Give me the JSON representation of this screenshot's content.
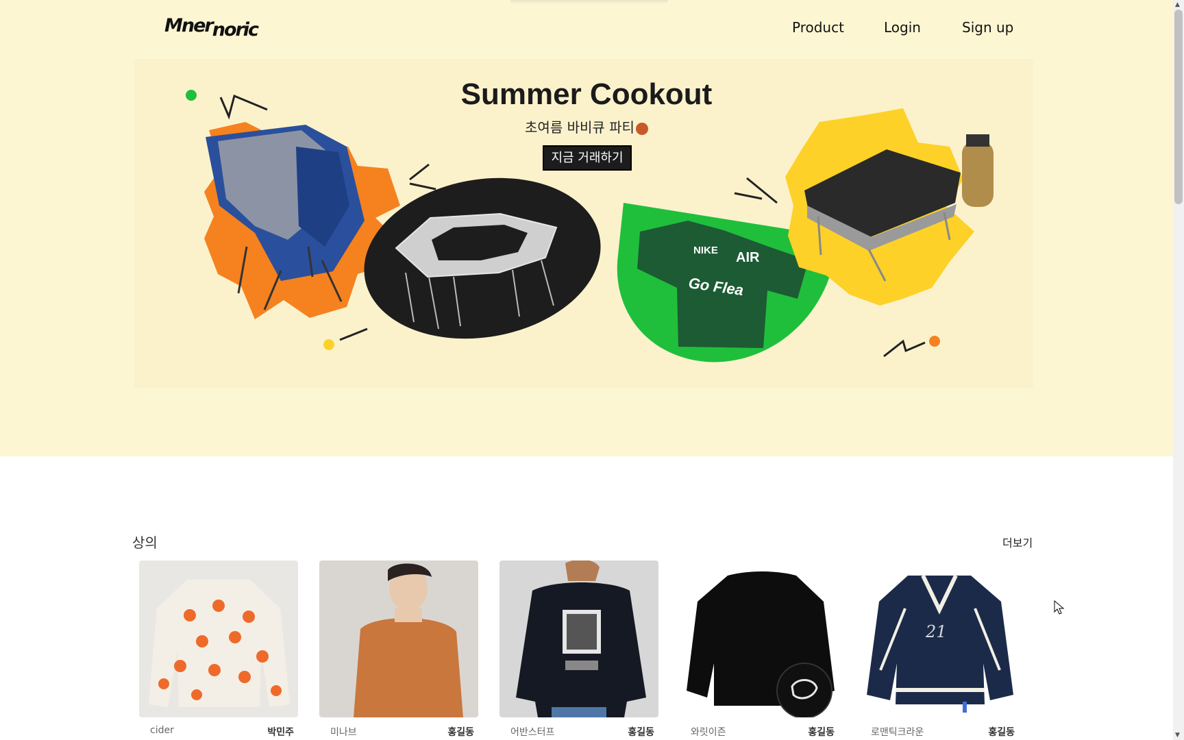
{
  "header": {
    "logo": {
      "part1": "Mner",
      "part2": "noric"
    },
    "nav": [
      {
        "label": "Product"
      },
      {
        "label": "Login"
      },
      {
        "label": "Sign up"
      }
    ]
  },
  "banner": {
    "title": "Summer Cookout",
    "subtitle": "초여름 바비큐 파티",
    "cta": "지금 거래하기",
    "colors": {
      "orange": "#f5821f",
      "black": "#1d1d1d",
      "green": "#1fbf3c",
      "yellow": "#fdd128",
      "background": "#fdf6d3"
    },
    "jersey_text": {
      "brand": "NIKE",
      "word": "AIR",
      "slogan": "Go Flea"
    }
  },
  "section": {
    "title": "상의",
    "more": "더보기",
    "products": [
      {
        "brand": "cider",
        "seller": "박민주"
      },
      {
        "brand": "미나브",
        "seller": "홍길동"
      },
      {
        "brand": "어반스터프",
        "seller": "홍길동"
      },
      {
        "brand": "와릿이즌",
        "seller": "홍길동"
      },
      {
        "brand": "로맨틱크라운",
        "seller": "홍길동"
      }
    ]
  }
}
